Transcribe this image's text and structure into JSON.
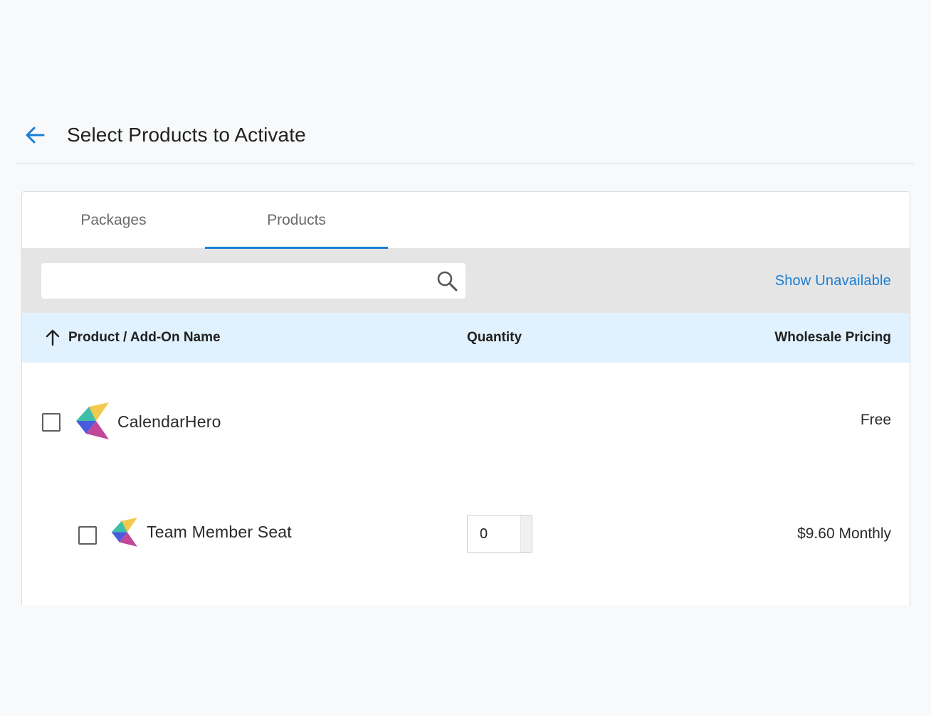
{
  "header": {
    "title": "Select Products to Activate",
    "back_icon": "arrow-left-icon"
  },
  "tabs": [
    {
      "label": "Packages",
      "active": false
    },
    {
      "label": "Products",
      "active": true
    }
  ],
  "toolbar": {
    "search_value": "",
    "search_placeholder": "",
    "show_unavailable_label": "Show Unavailable"
  },
  "table": {
    "columns": {
      "name": "Product / Add-On Name",
      "quantity": "Quantity",
      "pricing": "Wholesale Pricing"
    },
    "sort": "ascending",
    "rows": [
      {
        "name": "CalendarHero",
        "price": "Free",
        "level": 0,
        "checked": false
      },
      {
        "name": "Team Member Seat",
        "price": "$9.60 Monthly",
        "level": 1,
        "checked": false,
        "quantity": "0"
      }
    ]
  },
  "colors": {
    "accent": "#1a7fd4",
    "toolbar_bg": "#e5e5e5",
    "table_header_bg": "#e1f1fd",
    "page_bg": "#f8f9fa"
  }
}
